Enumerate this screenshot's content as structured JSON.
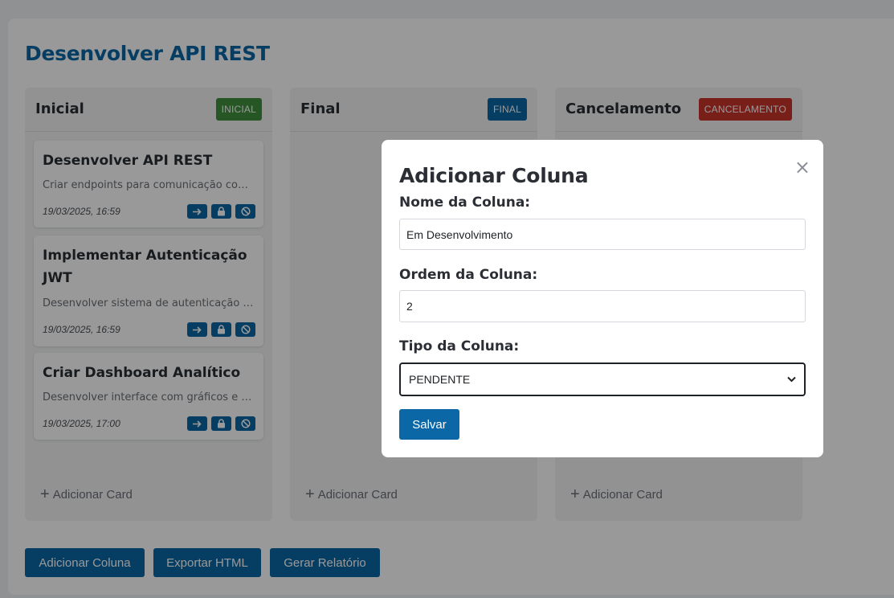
{
  "board": {
    "title": "Desenvolver API REST"
  },
  "columns": [
    {
      "title": "Inicial",
      "badge": "INICIAL",
      "badge_color": "#3f8f3c",
      "add_card_label": "Adicionar Card",
      "cards": [
        {
          "title": "Desenvolver API REST",
          "description": "Criar endpoints para comunicação com o ...",
          "date": "19/03/2025, 16:59"
        },
        {
          "title": "Implementar Autenticação JWT",
          "description": "Desenvolver sistema de autenticação co...",
          "date": "19/03/2025, 16:59"
        },
        {
          "title": "Criar Dashboard Analítico",
          "description": "Desenvolver interface com gráficos e mét...",
          "date": "19/03/2025, 17:00"
        }
      ]
    },
    {
      "title": "Final",
      "badge": "FINAL",
      "badge_color": "#0b67a5",
      "add_card_label": "Adicionar Card",
      "cards": []
    },
    {
      "title": "Cancelamento",
      "badge": "CANCELAMENTO",
      "badge_color": "#c9342a",
      "add_card_label": "Adicionar Card",
      "cards": []
    }
  ],
  "card_actions": [
    "arrow-right-icon",
    "lock-icon",
    "block-icon"
  ],
  "footer": {
    "add_column": "Adicionar Coluna",
    "export_html": "Exportar HTML",
    "report": "Gerar Relatório"
  },
  "modal": {
    "title": "Adicionar Coluna",
    "close": "×",
    "name_label": "Nome da Coluna:",
    "name_value": "Em Desenvolvimento",
    "order_label": "Ordem da Coluna:",
    "order_value": "2",
    "type_label": "Tipo da Coluna:",
    "type_value": "PENDENTE",
    "save": "Salvar"
  },
  "colors": {
    "accent": "#0b67a5",
    "overlay": "rgba(0,0,0,0.40)"
  }
}
